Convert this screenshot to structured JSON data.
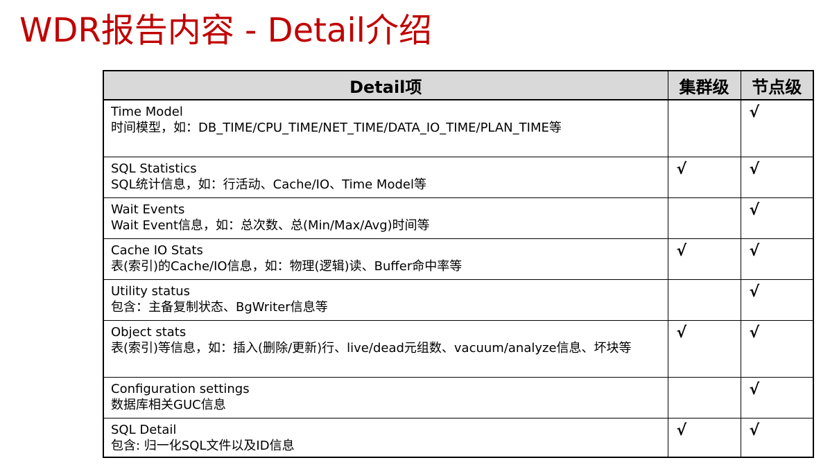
{
  "slide": {
    "title": "WDR报告内容 - Detail介绍"
  },
  "table": {
    "headers": {
      "detail": "Detail项",
      "cluster": "集群级",
      "node": "节点级"
    },
    "rows": [
      {
        "name": "Time Model",
        "desc": "时间模型，如：DB_TIME/CPU_TIME/NET_TIME/DATA_IO_TIME/PLAN_TIME等",
        "cluster": "",
        "node": "√"
      },
      {
        "name": "SQL Statistics",
        "desc": "SQL统计信息，如：行活动、Cache/IO、Time Model等",
        "cluster": "√",
        "node": "√"
      },
      {
        "name": "Wait Events",
        "desc": "Wait Event信息，如：总次数、总(Min/Max/Avg)时间等",
        "cluster": "",
        "node": "√"
      },
      {
        "name": "Cache IO Stats",
        "desc": "表(索引)的Cache/IO信息，如：物理(逻辑)读、Buffer命中率等",
        "cluster": "√",
        "node": "√"
      },
      {
        "name": "Utility status",
        "desc": "包含：主备复制状态、BgWriter信息等",
        "cluster": "",
        "node": "√"
      },
      {
        "name": "Object stats",
        "desc": "表(索引)等信息，如：插入(删除/更新)行、live/dead元组数、vacuum/analyze信息、坏块等",
        "cluster": "√",
        "node": "√"
      },
      {
        "name": "Configuration settings",
        "desc": "数据库相关GUC信息",
        "cluster": "",
        "node": "√"
      },
      {
        "name": "SQL Detail",
        "desc": "包含: 归一化SQL文件以及ID信息",
        "cluster": "√",
        "node": "√"
      }
    ]
  }
}
